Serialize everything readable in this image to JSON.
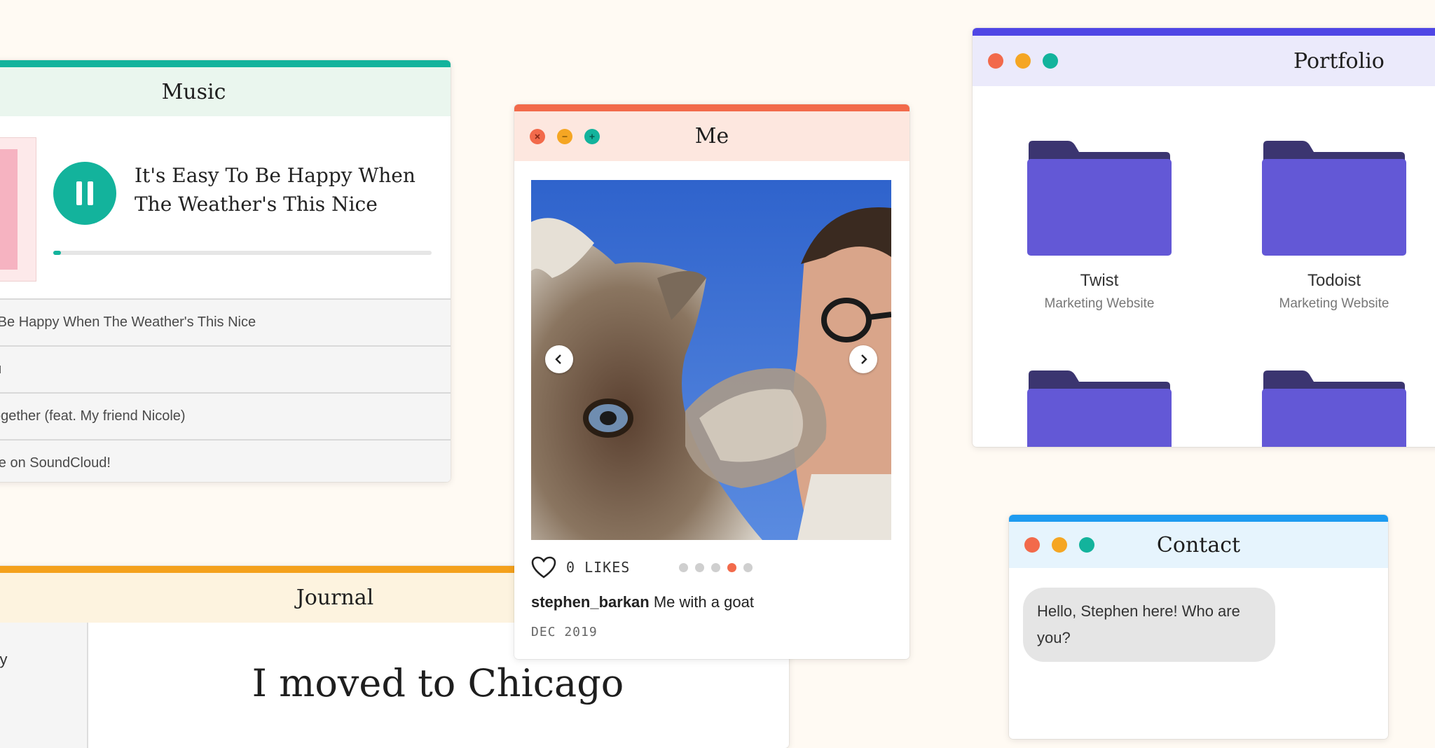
{
  "colors": {
    "background": "#fffaf3",
    "music_accent": "#13b39c",
    "me_accent": "#f26a4b",
    "portfolio_accent": "#4f46e5",
    "folder": "#6358d6",
    "folder_tab": "#3b3570",
    "contact_accent": "#1e9bf0",
    "journal_accent": "#f4a11c"
  },
  "music": {
    "title": "Music",
    "now_playing": "It's Easy To Be Happy When The Weather's This Nice",
    "play_state_icon": "pause-icon",
    "progress_fraction": 0.02,
    "tracks": [
      "o Be Happy When The Weather's This Nice",
      "ou",
      "Together (feat. My friend Nicole)",
      "ore on SoundCloud!"
    ]
  },
  "me": {
    "title": "Me",
    "likes": "0 LIKES",
    "carousel_active_index": 3,
    "carousel_count": 5,
    "username": "stephen_barkan",
    "caption": "Me with a goat",
    "date": "DEC 2019"
  },
  "portfolio": {
    "title": "Portfolio",
    "folders": [
      {
        "name": "Twist",
        "subtitle": "Marketing Website"
      },
      {
        "name": "Todoist",
        "subtitle": "Marketing Website"
      },
      {
        "name": "",
        "subtitle": ""
      },
      {
        "name": "",
        "subtitle": ""
      }
    ]
  },
  "contact": {
    "title": "Contact",
    "message": "Hello, Stephen here! Who are you?"
  },
  "journal": {
    "title": "Journal",
    "sidebar_item": "ory",
    "entry_title": "I moved to Chicago"
  }
}
